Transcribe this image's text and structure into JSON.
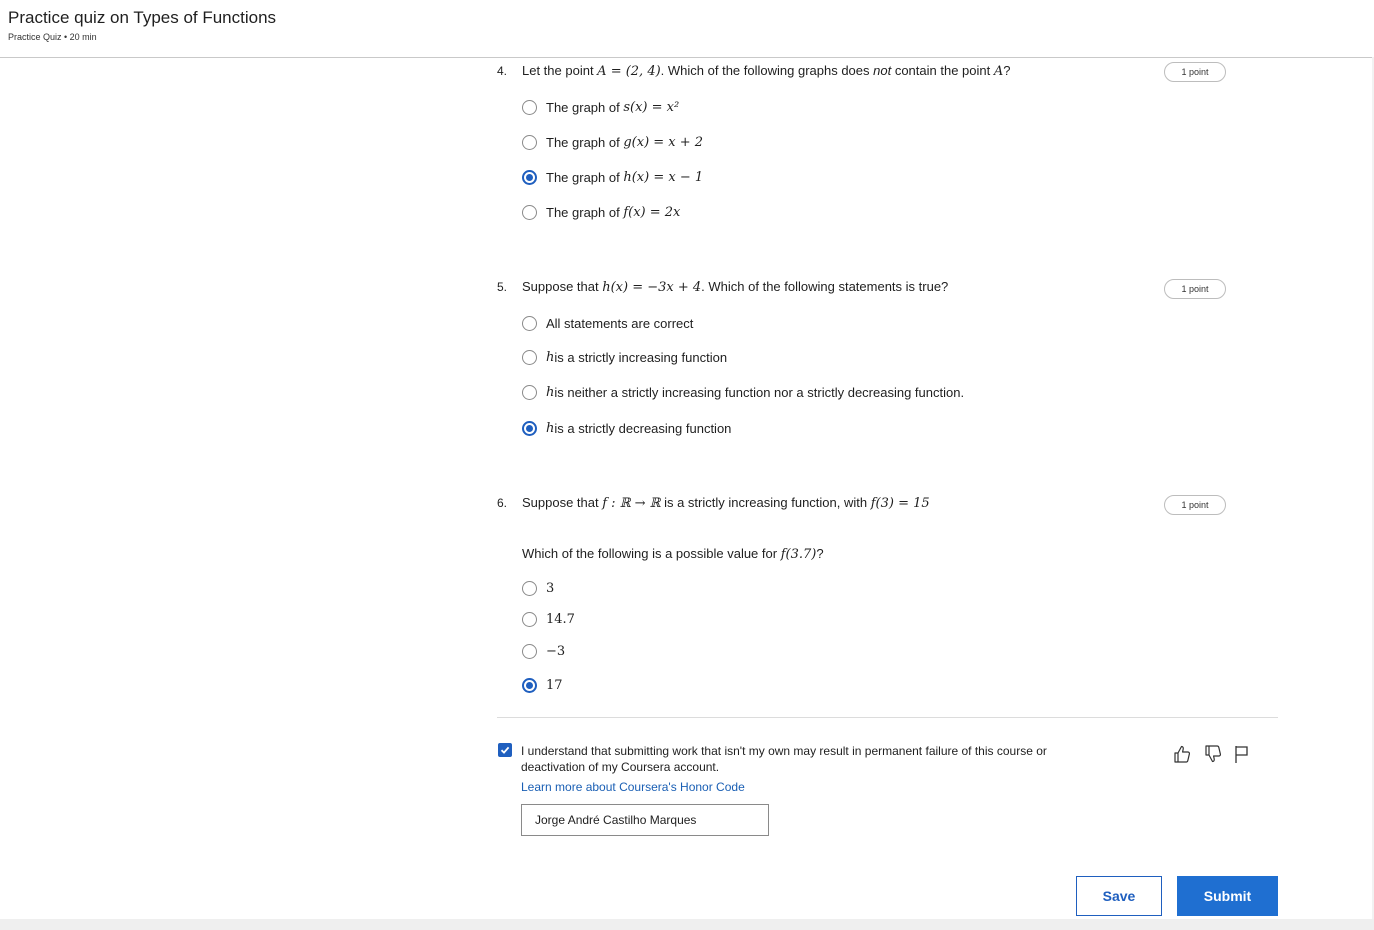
{
  "header": {
    "title": "Practice quiz on Types of Functions",
    "subtitle": "Practice Quiz • 20 min"
  },
  "questions": [
    {
      "number": "4.",
      "points": "1 point",
      "prompt": {
        "p1": "Let the point ",
        "m1": "A = (2, 4)",
        "p2": ". Which of the following graphs does ",
        "em": "not",
        "p3": " contain the point ",
        "m2": "A",
        "p4": "?"
      },
      "options": [
        {
          "prefix": "The graph of ",
          "math": "s(x) = x²",
          "selected": false
        },
        {
          "prefix": "The graph of ",
          "math": "g(x) = x + 2",
          "selected": false
        },
        {
          "prefix": "The graph of ",
          "math": "h(x) = x − 1",
          "selected": true
        },
        {
          "prefix": "The graph of ",
          "math": "f(x) = 2x",
          "selected": false
        }
      ]
    },
    {
      "number": "5.",
      "points": "1 point",
      "prompt": {
        "p1": "Suppose that ",
        "m1": "h(x) = −3x + 4",
        "p2": ". Which of the following statements is true?"
      },
      "options": [
        {
          "math": "",
          "text": "All statements are correct",
          "selected": false
        },
        {
          "math": "h",
          "text": " is a strictly increasing function",
          "selected": false
        },
        {
          "math": "h",
          "text": " is neither a strictly increasing function nor a strictly decreasing function.",
          "selected": false
        },
        {
          "math": "h",
          "text": " is a strictly decreasing function",
          "selected": true
        }
      ]
    },
    {
      "number": "6.",
      "points": "1 point",
      "prompt": {
        "p1": "Suppose that ",
        "m1": "f : ℝ → ℝ",
        "p2": " is a strictly increasing function, with ",
        "m2": "f(3) = 15"
      },
      "prompt2": {
        "p1": "Which of the following is a possible value for ",
        "m1": "f(3.7)",
        "p2": "?"
      },
      "options": [
        {
          "math": "3",
          "selected": false
        },
        {
          "math": "14.7",
          "selected": false
        },
        {
          "math": "−3",
          "selected": false
        },
        {
          "math": "17",
          "selected": true
        }
      ]
    }
  ],
  "honor": {
    "checked": true,
    "text": "I understand that submitting work that isn't my own may result in permanent failure of this course or deactivation of my Coursera account.",
    "link": "Learn more about Coursera's Honor Code",
    "name_value": "Jorge André Castilho Marques"
  },
  "feedback_icons": [
    "thumbs-up-icon",
    "thumbs-down-icon",
    "flag-icon"
  ],
  "buttons": {
    "save": "Save",
    "submit": "Submit"
  },
  "colors": {
    "accent": "#1f5fbf",
    "submit_bg": "#1f6fd1",
    "link": "#1a5fb4"
  }
}
